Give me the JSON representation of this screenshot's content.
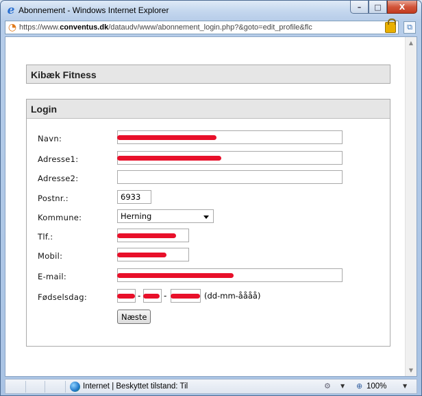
{
  "window": {
    "title": "Abonnement - Windows Internet Explorer",
    "minimize_label": "–",
    "maximize_label": "□",
    "close_label": "X"
  },
  "address": {
    "url_prefix": "https://www.",
    "url_domain": "conventus.dk",
    "url_path": "/dataudv/www/abonnement_login.php?&goto=edit_profile&flc"
  },
  "page": {
    "club_name": "Kibæk Fitness",
    "login_heading": "Login"
  },
  "form": {
    "navn_label": "Navn:",
    "adresse1_label": "Adresse1:",
    "adresse2_label": "Adresse2:",
    "adresse2_value": "",
    "postnr_label": "Postnr.:",
    "postnr_value": "6933",
    "kommune_label": "Kommune:",
    "kommune_value": "Herning",
    "tlf_label": "Tlf.:",
    "mobil_label": "Mobil:",
    "email_label": "E-mail:",
    "foedselsdag_label": "Fødselsdag:",
    "date_separator": "-",
    "date_hint": "(dd-mm-åååå)",
    "next_button": "Næste"
  },
  "statusbar": {
    "zone_text": "Internet | Beskyttet tilstand: Til",
    "zoom_text": "100%"
  },
  "colors": {
    "redaction": "#e8102a",
    "panel_header_bg": "#e6e6e6"
  }
}
